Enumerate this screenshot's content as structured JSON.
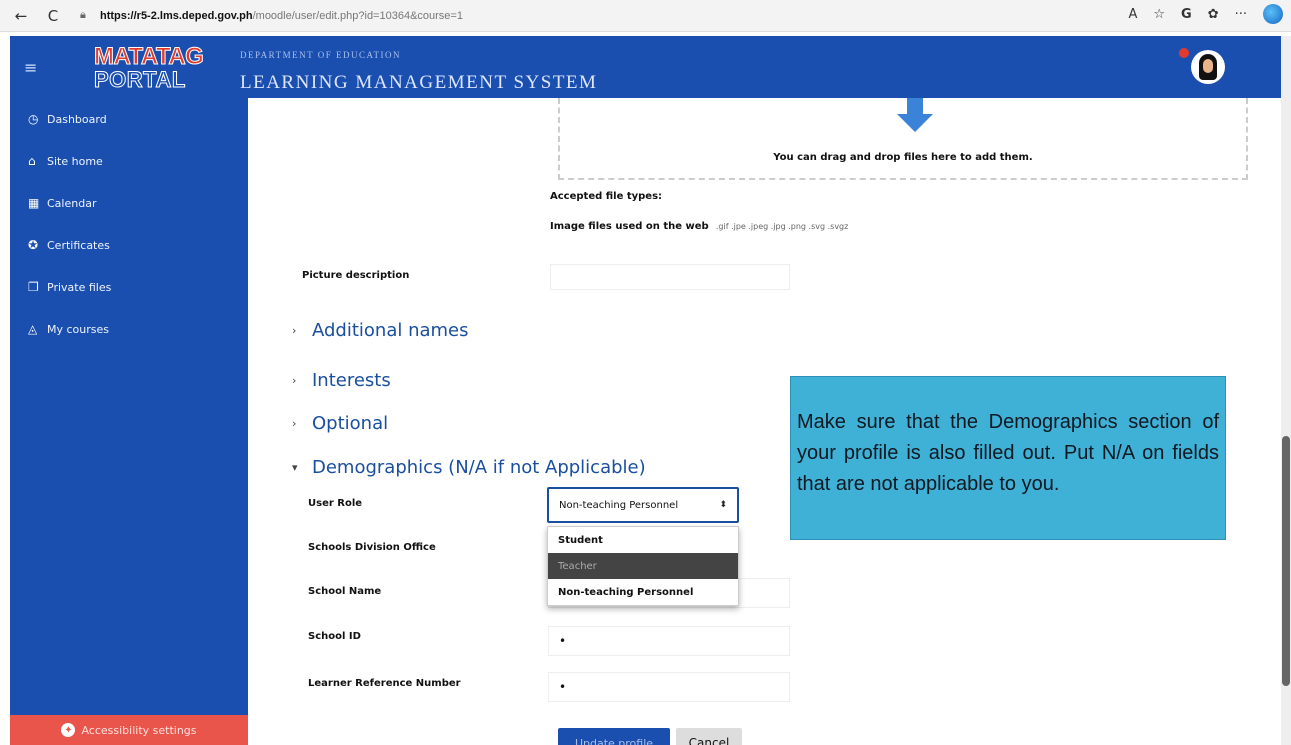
{
  "browser": {
    "back": "←",
    "reload": "C",
    "url_host": "https://r5-2.lms.deped.gov.ph",
    "url_path": "/moodle/user/edit.php?id=10364&course=1",
    "icons": [
      "read-aloud-icon",
      "favorite-icon",
      "profile-icon",
      "extensions-icon",
      "more-icon",
      "edge-copilot-icon"
    ]
  },
  "header": {
    "logo_line1": "MATATAG",
    "logo_line2": "PORTAL",
    "department": "DEPARTMENT OF EDUCATION",
    "system_name": "LEARNING MANAGEMENT SYSTEM"
  },
  "sidebar": {
    "items": [
      {
        "label": "Dashboard",
        "icon": "dashboard-icon"
      },
      {
        "label": "Site home",
        "icon": "home-icon"
      },
      {
        "label": "Calendar",
        "icon": "calendar-icon"
      },
      {
        "label": "Certificates",
        "icon": "certificate-icon"
      },
      {
        "label": "Private files",
        "icon": "file-icon"
      },
      {
        "label": "My courses",
        "icon": "graduation-cap-icon"
      }
    ],
    "accessibility": "Accessibility settings"
  },
  "upload": {
    "drop_text": "You can drag and drop files here to add them.",
    "accepted_label": "Accepted file types:",
    "image_files_label": "Image files used on the web",
    "image_exts": ".gif .jpe .jpeg .jpg .png .svg .svgz"
  },
  "form": {
    "picture_description": "Picture description",
    "sections": [
      {
        "label": "Additional names",
        "expanded": false
      },
      {
        "label": "Interests",
        "expanded": false
      },
      {
        "label": "Optional",
        "expanded": false
      },
      {
        "label": "Demographics (N/A if not Applicable)",
        "expanded": true
      }
    ],
    "user_role_label": "User Role",
    "user_role_value": "Non-teaching Personnel",
    "role_options": [
      "Student",
      "Teacher",
      "Non-teaching Personnel"
    ],
    "division_label": "Schools Division Office",
    "school_name_label": "School Name",
    "school_id_label": "School ID",
    "school_id_value": "•",
    "lrn_label": "Learner Reference Number",
    "lrn_value": "•",
    "update_button": "Update profile",
    "cancel_button": "Cancel"
  },
  "note": {
    "text": "Make sure that the Demographics section of your profile is also filled out. Put N/A on fields that are not applicable to you."
  },
  "colors": {
    "brand_blue": "#1a4fb0",
    "accent_red": "#e9554a",
    "note_cyan": "#3fb0d6"
  }
}
